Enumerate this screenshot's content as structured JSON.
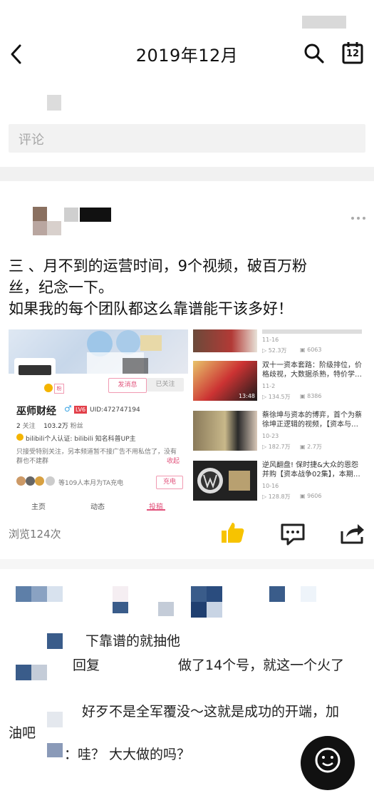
{
  "header": {
    "title": "2019年12月",
    "calendar_badge": "12"
  },
  "comment_box": {
    "placeholder": "评论"
  },
  "post": {
    "line1": "三 、月不到的运营时间，9个视频，破百万粉",
    "line2": "丝，纪念一下。",
    "line3": "如果我的每个团队都这么靠谱能干该多好！"
  },
  "bili_card": {
    "name": "巫师财经",
    "level": "LV6",
    "uid": "UID:472747194",
    "follow_count": "2",
    "follow_label": "关注",
    "fans_count": "103.2万",
    "fans_label": "粉丝",
    "cert": "bilibili个人认证: bilibili 知名科普UP主",
    "bio": "只接受特别关注，另本频道暂不接广告不用私信了，没有",
    "bio2": "群也不建群",
    "collapse": "收起",
    "send_msg": "发消息",
    "followed": "已关注",
    "charge_text": "等109人本月为TA充电",
    "charge_btn": "充电",
    "tabs": [
      "主页",
      "动态",
      "投稿"
    ]
  },
  "videos": [
    {
      "title": "",
      "date": "11-16",
      "plays": "52.3万",
      "danmaku": "6063",
      "duration": ""
    },
    {
      "title": "双十一资本套路：阶级排位，价格歧视，大数据杀熟，特价学…",
      "date": "11-2",
      "plays": "134.5万",
      "danmaku": "8386",
      "duration": "13:48"
    },
    {
      "title": "蔡徐坤与资本的博弈，首个为蔡徐坤正逻辑的视频，【资本与…",
      "date": "10-23",
      "plays": "182.7万",
      "danmaku": "2.7万",
      "duration": ""
    },
    {
      "title": "逆风翻盘! 保时捷&大众的恩怨并购【资本战争02集】，本期…",
      "date": "10-16",
      "plays": "128.8万",
      "danmaku": "9606",
      "duration": ""
    }
  ],
  "stats": {
    "views": "浏览124次"
  },
  "comments": [
    {
      "text": "下靠谱的就抽他"
    },
    {
      "text_a": "回复",
      "text_b": "做了14个号，就这一个火了"
    },
    {
      "text": "好歹不是全军覆没～这就是成功的开端，加"
    },
    {
      "text": "油吧"
    },
    {
      "text": "：哇？ 大大做的吗？"
    }
  ]
}
